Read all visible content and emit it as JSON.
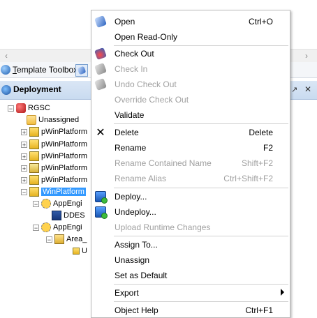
{
  "toolbox": {
    "label": "Template Toolbox"
  },
  "deployment": {
    "title": "Deployment",
    "pin_glyph": "↗",
    "close_glyph": "✕"
  },
  "scrollbar": {
    "right_arrow": "›"
  },
  "tree": [
    {
      "label": "RGSC"
    },
    {
      "label": "Unassigned"
    },
    {
      "label": "pWinPlatform"
    },
    {
      "label": "pWinPlatform"
    },
    {
      "label": "pWinPlatform"
    },
    {
      "label": "pWinPlatform"
    },
    {
      "label": "pWinPlatform"
    },
    {
      "label": "WinPlatform"
    },
    {
      "label": "AppEngi"
    },
    {
      "label": "DDES"
    },
    {
      "label": "AppEngi"
    },
    {
      "label": "Area_"
    },
    {
      "label": "U"
    }
  ],
  "menu": {
    "items": [
      {
        "label": "Open",
        "shortcut": "Ctrl+O",
        "icon": "pen-icon",
        "enabled": true
      },
      {
        "label": "Open Read-Only",
        "shortcut": "",
        "icon": "",
        "enabled": true
      },
      {
        "label": "Check Out",
        "shortcut": "",
        "icon": "check-out-icon",
        "enabled": true
      },
      {
        "label": "Check In",
        "shortcut": "",
        "icon": "check-in-icon",
        "enabled": false
      },
      {
        "label": "Undo Check Out",
        "shortcut": "",
        "icon": "undo-check-out-icon",
        "enabled": false
      },
      {
        "label": "Override Check Out",
        "shortcut": "",
        "icon": "",
        "enabled": false
      },
      {
        "label": "Validate",
        "shortcut": "",
        "icon": "",
        "enabled": true
      },
      {
        "label": "Delete",
        "shortcut": "Delete",
        "icon": "delete-x-icon",
        "enabled": true
      },
      {
        "label": "Rename",
        "shortcut": "F2",
        "icon": "",
        "enabled": true
      },
      {
        "label": "Rename Contained Name",
        "shortcut": "Shift+F2",
        "icon": "",
        "enabled": false
      },
      {
        "label": "Rename Alias",
        "shortcut": "Ctrl+Shift+F2",
        "icon": "",
        "enabled": false
      },
      {
        "label": "Deploy...",
        "shortcut": "",
        "icon": "deploy-icon",
        "enabled": true
      },
      {
        "label": "Undeploy...",
        "shortcut": "",
        "icon": "undeploy-icon",
        "enabled": true
      },
      {
        "label": "Upload Runtime Changes",
        "shortcut": "",
        "icon": "",
        "enabled": false
      },
      {
        "label": "Assign To...",
        "shortcut": "",
        "icon": "",
        "enabled": true
      },
      {
        "label": "Unassign",
        "shortcut": "",
        "icon": "",
        "enabled": true
      },
      {
        "label": "Set as Default",
        "shortcut": "",
        "icon": "",
        "enabled": true
      },
      {
        "label": "Export",
        "shortcut": "",
        "icon": "",
        "enabled": true,
        "submenu": true
      },
      {
        "label": "Object Help",
        "shortcut": "Ctrl+F1",
        "icon": "",
        "enabled": true
      }
    ]
  },
  "colors": {
    "selection": "#3399ff",
    "disabled_text": "#a0a0a0"
  }
}
